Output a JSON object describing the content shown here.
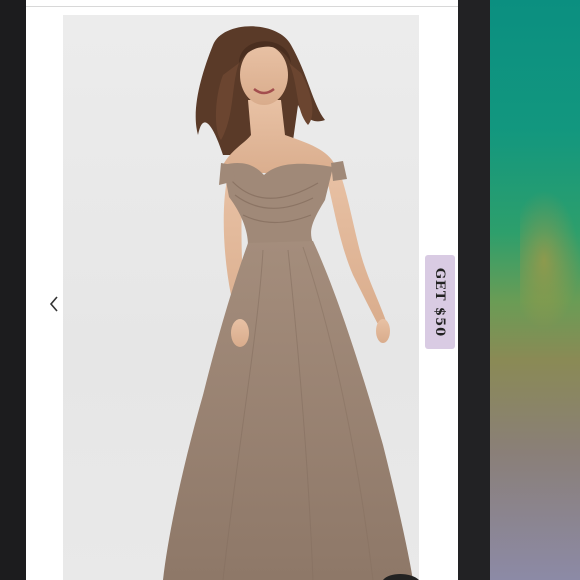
{
  "page": {
    "badge_label": "GET $50"
  },
  "icons": {
    "prev": "chevron-left-icon"
  },
  "colors": {
    "page_background": "#ffffff",
    "photo_background": "#e8e8e8",
    "dress": "#9c8474",
    "badge_background": "#d9cbe3",
    "bezel": "#1f1f21"
  }
}
